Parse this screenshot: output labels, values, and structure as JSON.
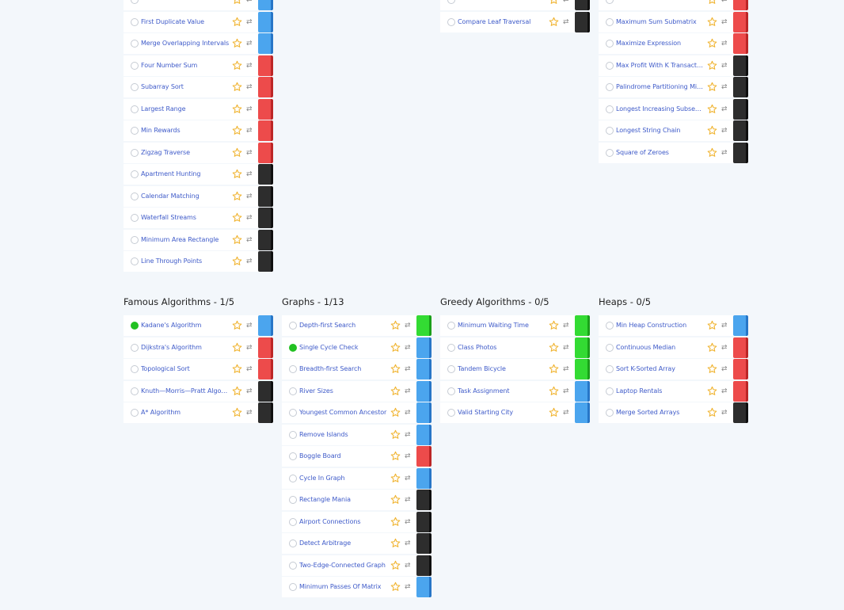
{
  "colors": {
    "blue": "#4ba5ee",
    "red": "#ed4b4b",
    "black": "#2d2d2d",
    "green": "#33db33",
    "completed": "#22c122",
    "star": "#f0b32f"
  },
  "top": [
    {
      "id": "col1",
      "items": [
        {
          "name": "",
          "diff": "blue",
          "done": false
        },
        {
          "name": "First Duplicate Value",
          "diff": "blue",
          "done": false
        },
        {
          "name": "Merge Overlapping Intervals",
          "diff": "blue",
          "done": false
        },
        {
          "name": "Four Number Sum",
          "diff": "red",
          "done": false
        },
        {
          "name": "Subarray Sort",
          "diff": "red",
          "done": false
        },
        {
          "name": "Largest Range",
          "diff": "red",
          "done": false
        },
        {
          "name": "Min Rewards",
          "diff": "red",
          "done": false
        },
        {
          "name": "Zigzag Traverse",
          "diff": "red",
          "done": false
        },
        {
          "name": "Apartment Hunting",
          "diff": "black",
          "done": false
        },
        {
          "name": "Calendar Matching",
          "diff": "black",
          "done": false
        },
        {
          "name": "Waterfall Streams",
          "diff": "black",
          "done": false
        },
        {
          "name": "Minimum Area Rectangle",
          "diff": "black",
          "done": false
        },
        {
          "name": "Line Through Points",
          "diff": "black",
          "done": false
        }
      ]
    },
    {
      "id": "col3",
      "items": [
        {
          "name": "",
          "diff": "black",
          "done": false
        },
        {
          "name": "Compare Leaf Traversal",
          "diff": "black",
          "done": false
        }
      ]
    },
    {
      "id": "col4",
      "items": [
        {
          "name": "",
          "diff": "red",
          "done": false
        },
        {
          "name": "Maximum Sum Submatrix",
          "diff": "red",
          "done": false
        },
        {
          "name": "Maximize Expression",
          "diff": "red",
          "done": false
        },
        {
          "name": "Max Profit With K Transactions",
          "diff": "black",
          "done": false
        },
        {
          "name": "Palindrome Partitioning Min Cuts",
          "diff": "black",
          "done": false
        },
        {
          "name": "Longest Increasing Subsequence",
          "diff": "black",
          "done": false
        },
        {
          "name": "Longest String Chain",
          "diff": "black",
          "done": false
        },
        {
          "name": "Square of Zeroes",
          "diff": "black",
          "done": false
        }
      ]
    }
  ],
  "sections": [
    {
      "title": "Famous Algorithms - 1/5",
      "items": [
        {
          "name": "Kadane's Algorithm",
          "diff": "blue",
          "done": true
        },
        {
          "name": "Dijkstra's Algorithm",
          "diff": "red",
          "done": false
        },
        {
          "name": "Topological Sort",
          "diff": "red",
          "done": false
        },
        {
          "name": "Knuth—Morris—Pratt Algorithm",
          "diff": "black",
          "done": false
        },
        {
          "name": "A* Algorithm",
          "diff": "black",
          "done": false
        }
      ]
    },
    {
      "title": "Graphs - 1/13",
      "items": [
        {
          "name": "Depth-first Search",
          "diff": "green",
          "done": false
        },
        {
          "name": "Single Cycle Check",
          "diff": "blue",
          "done": true
        },
        {
          "name": "Breadth-first Search",
          "diff": "blue",
          "done": false
        },
        {
          "name": "River Sizes",
          "diff": "blue",
          "done": false
        },
        {
          "name": "Youngest Common Ancestor",
          "diff": "blue",
          "done": false
        },
        {
          "name": "Remove Islands",
          "diff": "blue",
          "done": false
        },
        {
          "name": "Boggle Board",
          "diff": "red",
          "done": false
        },
        {
          "name": "Cycle In Graph",
          "diff": "blue",
          "done": false
        },
        {
          "name": "Rectangle Mania",
          "diff": "black",
          "done": false
        },
        {
          "name": "Airport Connections",
          "diff": "black",
          "done": false
        },
        {
          "name": "Detect Arbitrage",
          "diff": "black",
          "done": false
        },
        {
          "name": "Two-Edge-Connected Graph",
          "diff": "black",
          "done": false
        },
        {
          "name": "Minimum Passes Of Matrix",
          "diff": "blue",
          "done": false
        }
      ]
    },
    {
      "title": "Greedy Algorithms - 0/5",
      "items": [
        {
          "name": "Minimum Waiting Time",
          "diff": "green",
          "done": false
        },
        {
          "name": "Class Photos",
          "diff": "green",
          "done": false
        },
        {
          "name": "Tandem Bicycle",
          "diff": "green",
          "done": false
        },
        {
          "name": "Task Assignment",
          "diff": "blue",
          "done": false
        },
        {
          "name": "Valid Starting City",
          "diff": "blue",
          "done": false
        }
      ]
    },
    {
      "title": "Heaps - 0/5",
      "items": [
        {
          "name": "Min Heap Construction",
          "diff": "blue",
          "done": false
        },
        {
          "name": "Continuous Median",
          "diff": "red",
          "done": false
        },
        {
          "name": "Sort K-Sorted Array",
          "diff": "red",
          "done": false
        },
        {
          "name": "Laptop Rentals",
          "diff": "red",
          "done": false
        },
        {
          "name": "Merge Sorted Arrays",
          "diff": "black",
          "done": false
        }
      ]
    }
  ]
}
